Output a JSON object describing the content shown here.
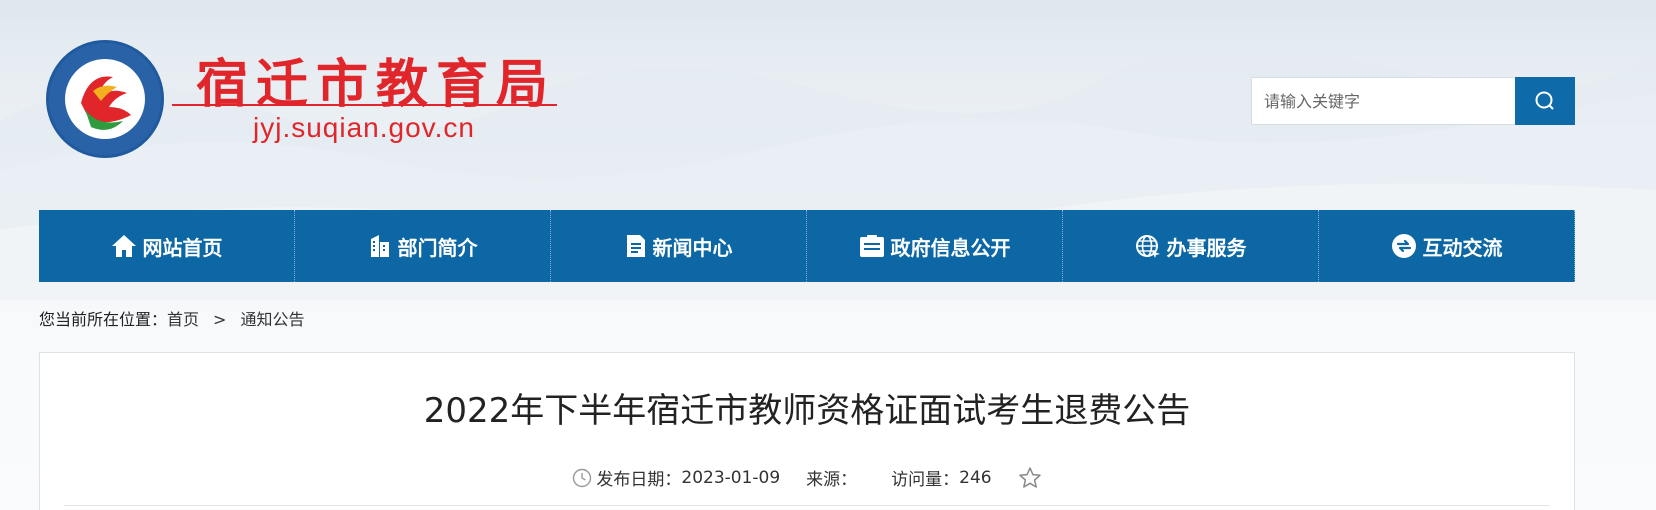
{
  "header": {
    "site_title": "宿迁市教育局",
    "site_url": "jyj.suqian.gov.cn",
    "emblem_ring_text": "宿迁市教育局"
  },
  "search": {
    "placeholder": "请输入关键字"
  },
  "nav": {
    "items": [
      {
        "label": "网站首页",
        "icon": "home-icon"
      },
      {
        "label": "部门简介",
        "icon": "building-icon"
      },
      {
        "label": "新闻中心",
        "icon": "document-icon"
      },
      {
        "label": "政府信息公开",
        "icon": "info-board-icon"
      },
      {
        "label": "办事服务",
        "icon": "globe-icon"
      },
      {
        "label": "互动交流",
        "icon": "exchange-icon"
      }
    ]
  },
  "breadcrumb": {
    "prefix": "您当前所在位置：",
    "home": "首页",
    "separator": ">",
    "current": "通知公告"
  },
  "article": {
    "title": "2022年下半年宿迁市教师资格证面试考生退费公告",
    "date_label": "发布日期：",
    "date": "2023-01-09",
    "source_label": "来源：",
    "source": "",
    "views_label": "访问量：",
    "views": "246"
  },
  "colors": {
    "brand_blue": "#0d67a5",
    "title_red": "#e0262a"
  }
}
